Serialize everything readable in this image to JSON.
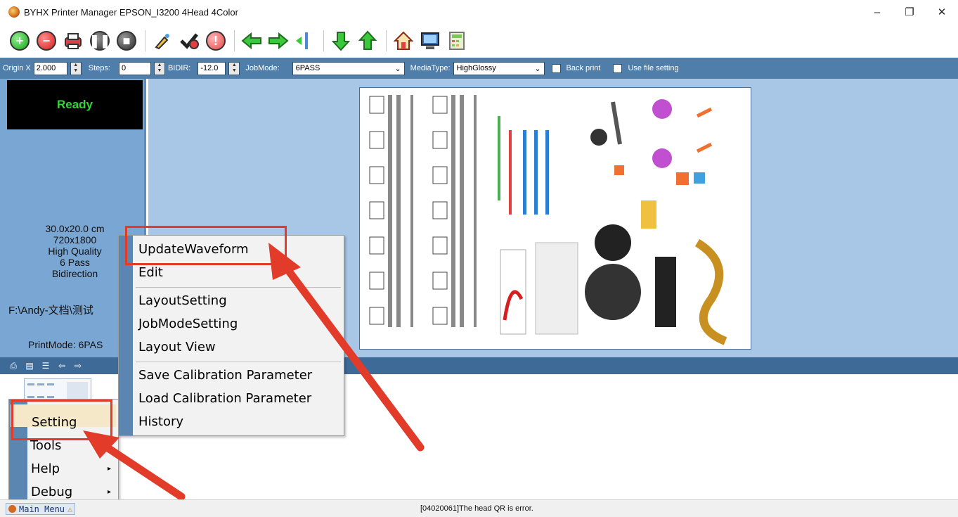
{
  "window": {
    "title": "BYHX  Printer Manager EPSON_I3200 4Head 4Color",
    "minimize": "–",
    "restore": "❐",
    "close": "✕"
  },
  "toolbar": {
    "buttons": [
      "add-icon",
      "remove-icon",
      "print-icon",
      "pause-icon",
      "stop-icon",
      "clean-icon",
      "check-icon",
      "alert-icon",
      "move-left-icon",
      "move-right-icon",
      "origin-icon",
      "down-icon",
      "up-icon",
      "home-icon",
      "monitor-icon",
      "calculator-icon"
    ]
  },
  "params": {
    "origin_x_label": "Origin X",
    "origin_x_value": "2.000",
    "steps_label": "Steps:",
    "steps_value": "0",
    "bidir_label": "BIDIR:",
    "bidir_value": "-12.0",
    "jobmode_label": "JobMode:",
    "jobmode_value": "6PASS",
    "mediatype_label": "MediaType:",
    "mediatype_value": "HighGlossy",
    "back_print_label": "Back print",
    "use_file_setting_label": "Use file setting"
  },
  "status_panel": {
    "state": "Ready",
    "size": "30.0x20.0 cm",
    "resolution": "720x1800",
    "quality": "High Quality",
    "pass": "6 Pass",
    "direction": "Bidirection",
    "path": "F:\\Andy-文档\\测试",
    "printmode": "PrintMode: 6PAS"
  },
  "main_menu": {
    "items": [
      {
        "label": "Setting",
        "has_submenu": false
      },
      {
        "label": "Tools",
        "has_submenu": false
      },
      {
        "label": "Help",
        "has_submenu": true
      },
      {
        "label": "Debug",
        "has_submenu": true
      }
    ]
  },
  "setting_menu": {
    "items": [
      "UpdateWaveform",
      "Edit",
      "LayoutSetting",
      "JobModeSetting",
      "Layout View",
      "Save Calibration Parameter",
      "Load Calibration Parameter",
      "History"
    ]
  },
  "statusbar": {
    "main_menu_label": "Main Menu",
    "message": "[04020061]The head QR is error."
  },
  "colors": {
    "accent": "#4f7eaa",
    "panel": "#7aa6d3",
    "preview_bg": "#a8c6e6",
    "ready_text": "#35d43a",
    "highlight": "#e23b2a"
  }
}
